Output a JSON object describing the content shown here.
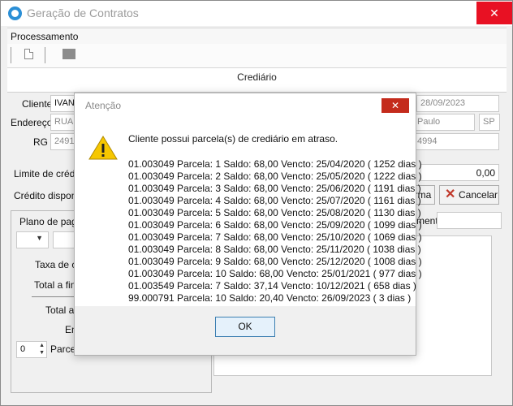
{
  "window": {
    "title": "Geração de Contratos",
    "minimize": "–",
    "maximize": "□",
    "close": "✕"
  },
  "menu": {
    "processamento": "Processamento"
  },
  "section": {
    "title": "Crediário"
  },
  "form": {
    "cliente_label": "Cliente",
    "cliente_value": "IVAN",
    "date_value": "28/09/2023",
    "endereco_label": "Endereço",
    "endereco_value": "RUA",
    "cidade_value": "Paulo",
    "uf_value": "SP",
    "rg_label": "RG",
    "rg_value": "2491",
    "phone_value": "4994",
    "limite_label": "Limite de crédito",
    "limite_value": "0,00",
    "credito_label": "Crédito disponível",
    "confirma_label": "rma",
    "cancelar_label": "Cancelar",
    "plano_label": "Plano de paga",
    "taxa_label": "Taxa de c",
    "total_fin_label": "Total a fina",
    "total_label": "Total a",
    "en_label": "En",
    "parcelas_value": "0",
    "parcelas_label": "Parcel",
    "mento_label": "mento"
  },
  "dialog": {
    "title": "Atenção",
    "close": "✕",
    "message": "Cliente possui parcela(s) de crediário em atraso.",
    "items": [
      "01.003049 Parcela: 1 Saldo: 68,00 Vencto: 25/04/2020 ( 1252 dias )",
      "01.003049 Parcela: 2 Saldo: 68,00 Vencto: 25/05/2020 ( 1222 dias )",
      "01.003049 Parcela: 3 Saldo: 68,00 Vencto: 25/06/2020 ( 1191 dias )",
      "01.003049 Parcela: 4 Saldo: 68,00 Vencto: 25/07/2020 ( 1161 dias )",
      "01.003049 Parcela: 5 Saldo: 68,00 Vencto: 25/08/2020 ( 1130 dias )",
      "01.003049 Parcela: 6 Saldo: 68,00 Vencto: 25/09/2020 ( 1099 dias )",
      "01.003049 Parcela: 7 Saldo: 68,00 Vencto: 25/10/2020 ( 1069 dias )",
      "01.003049 Parcela: 8 Saldo: 68,00 Vencto: 25/11/2020 ( 1038 dias )",
      "01.003049 Parcela: 9 Saldo: 68,00 Vencto: 25/12/2020 ( 1008 dias )",
      "01.003049 Parcela: 10 Saldo: 68,00 Vencto: 25/01/2021 ( 977 dias )",
      "01.003549 Parcela: 7 Saldo: 37,14 Vencto: 10/12/2021 ( 658 dias )",
      "99.000791 Parcela: 10 Saldo: 20,40 Vencto: 26/09/2023 ( 3 dias )"
    ],
    "ok_label": "OK"
  }
}
